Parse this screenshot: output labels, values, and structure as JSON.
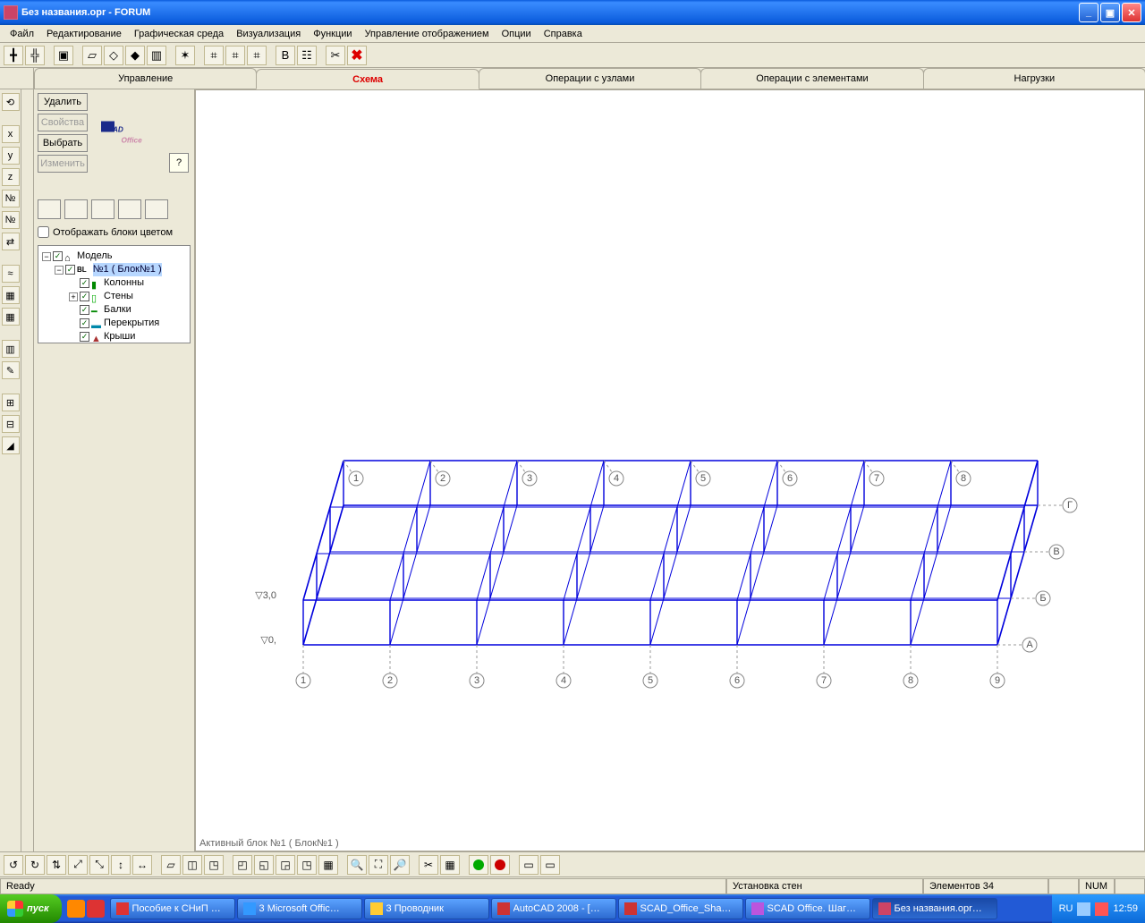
{
  "title": "Без названия.opr  -  FORUM",
  "win_buttons": {
    "min": "_",
    "max": "▣",
    "close": "✕"
  },
  "menu": [
    "Файл",
    "Редактирование",
    "Графическая среда",
    "Визуализация",
    "Функции",
    "Управление отображением",
    "Опции",
    "Справка"
  ],
  "tabs": [
    "Управление",
    "Схема",
    "Операции с узлами",
    "Операции с элементами",
    "Нагрузки"
  ],
  "active_tab": 1,
  "side_buttons": {
    "delete": "Удалить",
    "props": "Свойства",
    "select": "Выбрать",
    "edit": "Изменить"
  },
  "side_checkbox": "Отображать блоки цветом",
  "tree": {
    "root": "Модель",
    "block": "№1 ( Блок№1 )",
    "children": [
      "Колонны",
      "Стены",
      "Балки",
      "Перекрытия",
      "Крыши"
    ]
  },
  "viewport_status": "Активный блок №1 ( Блок№1 )",
  "grid_axes": {
    "num_top": [
      "1",
      "2",
      "3",
      "4",
      "5",
      "6",
      "7",
      "8"
    ],
    "num_bottom": [
      "1",
      "2",
      "3",
      "4",
      "5",
      "6",
      "7",
      "8",
      "9"
    ],
    "letters": [
      "А",
      "Б",
      "В",
      "Г"
    ],
    "levels": [
      "0,",
      "3,0"
    ]
  },
  "status": {
    "ready": "Ready",
    "hint": "Установка стен",
    "elements": "Элементов 34",
    "kb": "NUM"
  },
  "taskbar": {
    "start": "пуск",
    "tasks": [
      {
        "label": "Пособие к СНиП …",
        "color": "#d33"
      },
      {
        "label": "3 Microsoft Offic…",
        "color": "#39f"
      },
      {
        "label": "3 Проводник",
        "color": "#fc3"
      },
      {
        "label": "AutoCAD 2008 - […",
        "color": "#c33"
      },
      {
        "label": "SCAD_Office_Sha…",
        "color": "#c33"
      },
      {
        "label": "SCAD Office. Шаг…",
        "color": "#b5d"
      },
      {
        "label": "Без названия.opr…",
        "color": "#c46",
        "active": true
      }
    ],
    "lang": "RU",
    "clock": "12:59"
  }
}
